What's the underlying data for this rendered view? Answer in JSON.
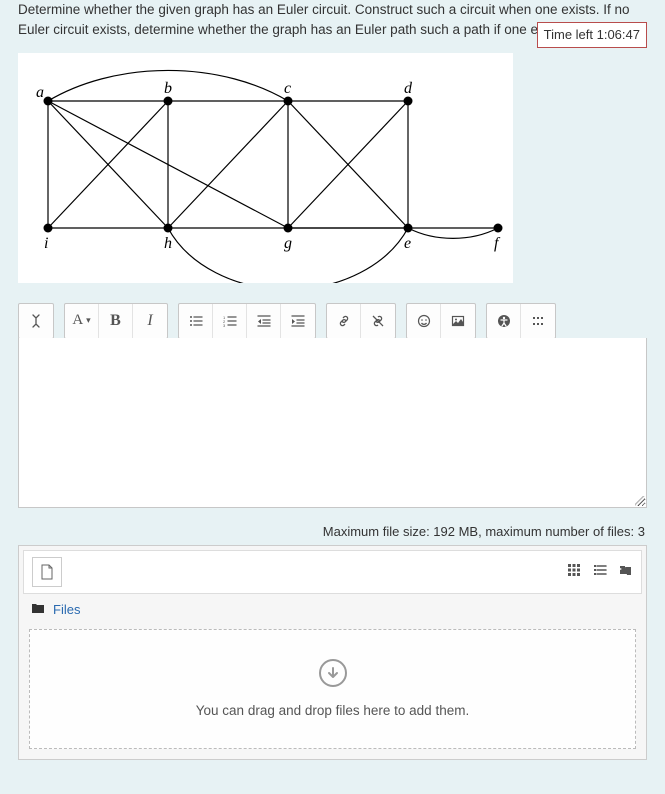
{
  "timer": {
    "label": "Time left 1:06:47"
  },
  "question": {
    "text": "Determine whether the given graph has an Euler circuit. Construct such a circuit when one exists. If no Euler circuit exists, determine whether the graph has an Euler path such a path if one exists."
  },
  "graph": {
    "vertices": [
      "a",
      "b",
      "c",
      "d",
      "i",
      "h",
      "g",
      "e",
      "f"
    ],
    "edges": [
      [
        "a",
        "c"
      ],
      [
        "a",
        "b"
      ],
      [
        "a",
        "i"
      ],
      [
        "a",
        "h"
      ],
      [
        "a",
        "g"
      ],
      [
        "b",
        "i"
      ],
      [
        "b",
        "h"
      ],
      [
        "b",
        "c"
      ],
      [
        "c",
        "h"
      ],
      [
        "c",
        "g"
      ],
      [
        "c",
        "d"
      ],
      [
        "c",
        "e"
      ],
      [
        "i",
        "h"
      ],
      [
        "h",
        "g"
      ],
      [
        "g",
        "e"
      ],
      [
        "g",
        "d"
      ],
      [
        "g",
        "f"
      ],
      [
        "d",
        "e"
      ],
      [
        "e",
        "f"
      ]
    ]
  },
  "toolbar": {
    "expand": "↕",
    "font_label": "A",
    "bold_label": "B",
    "italic_label": "I"
  },
  "upload": {
    "info": "Maximum file size: 192 MB, maximum number of files: 3",
    "files_label": "Files",
    "drop_hint": "You can drag and drop files here to add them."
  }
}
